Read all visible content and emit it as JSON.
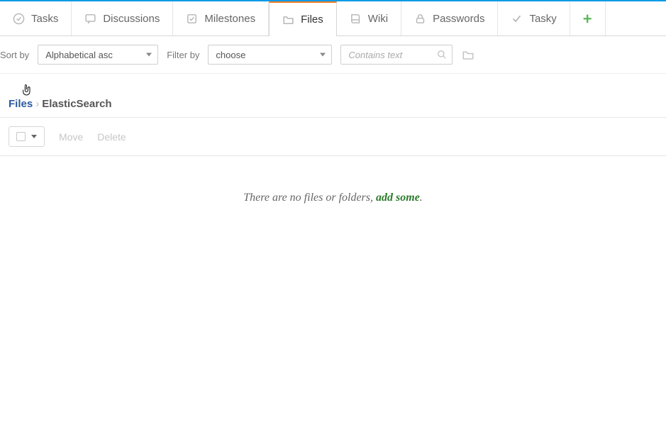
{
  "tabs": {
    "tasks": "Tasks",
    "discussions": "Discussions",
    "milestones": "Milestones",
    "files": "Files",
    "wiki": "Wiki",
    "passwords": "Passwords",
    "tasky": "Tasky"
  },
  "filters": {
    "sort_label": "Sort by",
    "sort_value": "Alphabetical asc",
    "filter_label": "Filter by",
    "filter_value": "choose",
    "search_placeholder": "Contains text"
  },
  "breadcrumb": {
    "root": "Files",
    "separator": "›",
    "current": "ElasticSearch"
  },
  "actions": {
    "move": "Move",
    "delete": "Delete"
  },
  "empty": {
    "prefix": "There are no files or folders, ",
    "link": "add some",
    "suffix": "."
  }
}
